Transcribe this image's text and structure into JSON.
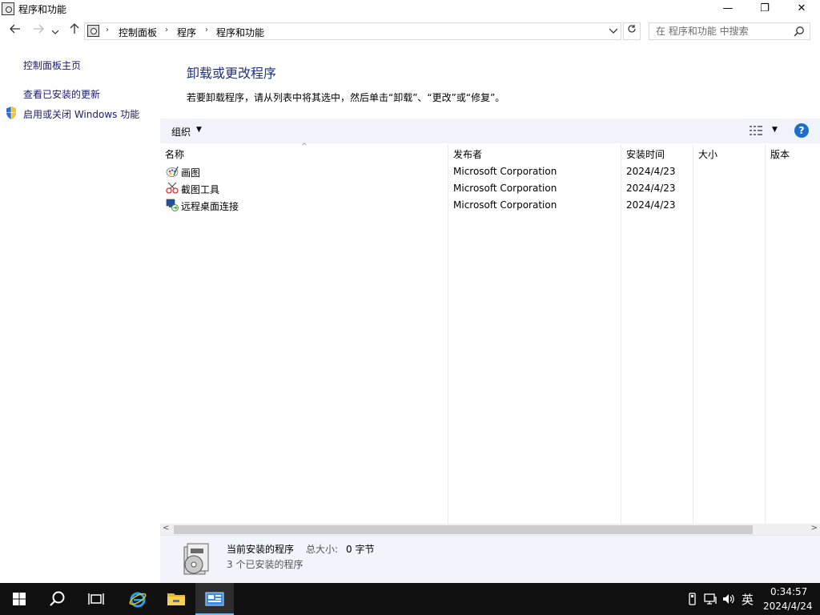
{
  "window": {
    "title": "程序和功能",
    "controls": {
      "minimize": "—",
      "maximize": "❐",
      "close": "✕"
    }
  },
  "address": {
    "crumbs": [
      "控制面板",
      "程序",
      "程序和功能"
    ],
    "search_placeholder": "在 程序和功能 中搜索"
  },
  "sidebar": {
    "links": [
      "控制面板主页",
      "查看已安装的更新",
      "启用或关闭 Windows 功能"
    ]
  },
  "main": {
    "heading": "卸载或更改程序",
    "description": "若要卸载程序，请从列表中将其选中，然后单击“卸载”、“更改”或“修复”。"
  },
  "toolbar": {
    "organize_label": "组织",
    "help_label": "?"
  },
  "table": {
    "columns": [
      "名称",
      "发布者",
      "安装时间",
      "大小",
      "版本"
    ],
    "rows": [
      {
        "icon": "paint-icon",
        "name": "画图",
        "publisher": "Microsoft Corporation",
        "installed": "2024/4/23",
        "size": "",
        "version": ""
      },
      {
        "icon": "snipping-tool-icon",
        "name": "截图工具",
        "publisher": "Microsoft Corporation",
        "installed": "2024/4/23",
        "size": "",
        "version": ""
      },
      {
        "icon": "remote-desktop-icon",
        "name": "远程桌面连接",
        "publisher": "Microsoft Corporation",
        "installed": "2024/4/23",
        "size": "",
        "version": ""
      }
    ]
  },
  "details": {
    "title": "当前安装的程序",
    "size_label": "总大小:",
    "size_value": "0 字节",
    "count": "3 个已安装的程序"
  },
  "taskbar": {
    "ime": "英",
    "time": "0:34:57",
    "date": "2024/4/24",
    "accent": "#76b9ed"
  }
}
